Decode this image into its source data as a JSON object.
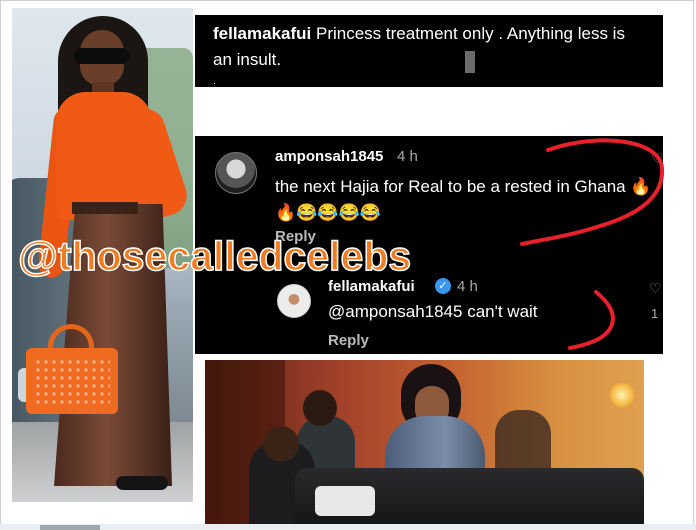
{
  "post": {
    "username": "fellamakafui",
    "caption_text": " Princess treatment only . Anything less is an insult.",
    "dot": "."
  },
  "comments": [
    {
      "username": "amponsah1845",
      "time": "4 h",
      "text": "the next Hajia for Real to be a rested in Ghana 🔥🔥😂😂😂😂",
      "reply_label": "Reply"
    },
    {
      "username": "fellamakafui",
      "verified": true,
      "time": "4 h",
      "text": "@amponsah1845 can't wait",
      "reply_label": "Reply",
      "side_count": "1"
    }
  ],
  "watermark": "@thosecalledcelebs",
  "icons": {
    "like": "heart-icon",
    "verified": "verified-badge-icon"
  },
  "colors": {
    "panel_bg": "#000000",
    "watermark": "#ef7c22",
    "annotation_red": "#e8202a",
    "verified": "#3897f0"
  }
}
